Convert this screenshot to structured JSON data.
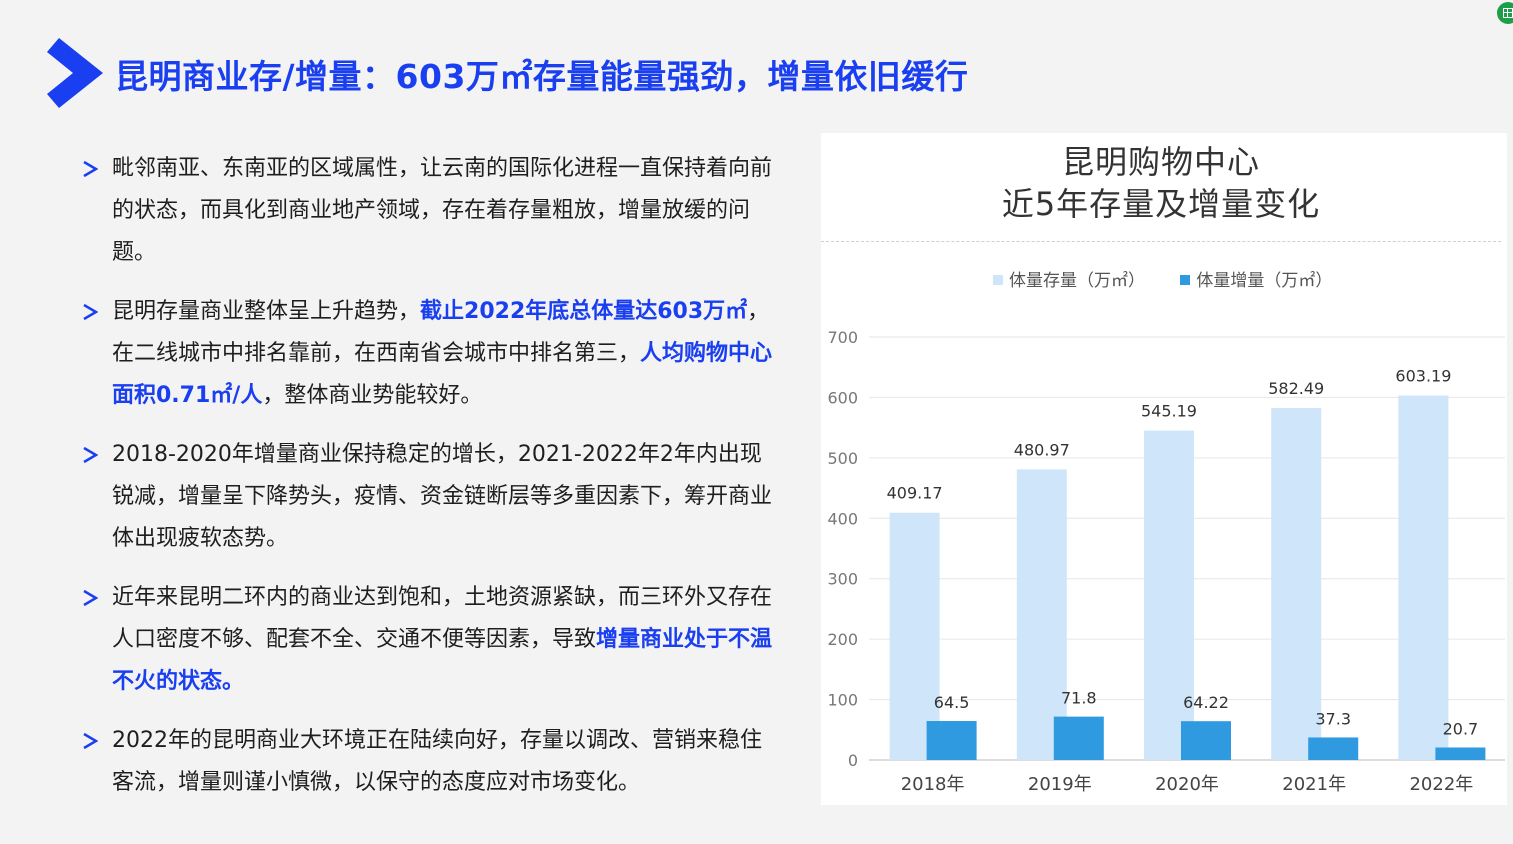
{
  "slide": {
    "title": "昆明商业存/增量：603万㎡存量能量强劲，增量依旧缓行",
    "corner_icon": "spreadsheet-icon",
    "accent_color": "#1a3ff0"
  },
  "bullets": [
    [
      {
        "text": "毗邻南亚、东南亚的区域属性，让云南的国际化进程一直保持着向前的状态，而具化到商业地产领域，存在着存量粗放，增量放缓的问题。",
        "hl": false
      }
    ],
    [
      {
        "text": "昆明存量商业整体呈上升趋势，",
        "hl": false
      },
      {
        "text": "截止2022年底总体量达603万㎡",
        "hl": true
      },
      {
        "text": "，在二线城市中排名靠前，在西南省会城市中排名第三，",
        "hl": false
      },
      {
        "text": "人均购物中心面积0.71㎡/人",
        "hl": true
      },
      {
        "text": "，整体商业势能较好。",
        "hl": false
      }
    ],
    [
      {
        "text": "2018-2020年增量商业保持稳定的增长，2021-2022年2年内出现锐减，增量呈下降势头，疫情、资金链断层等多重因素下，筹开商业体出现疲软态势。",
        "hl": false
      }
    ],
    [
      {
        "text": "近年来昆明二环内的商业达到饱和，土地资源紧缺，而三环外又存在人口密度不够、配套不全、交通不便等因素，导致",
        "hl": false
      },
      {
        "text": "增量商业处于不温不火的状态。",
        "hl": true
      }
    ],
    [
      {
        "text": "2022年的昆明商业大环境正在陆续向好，存量以调改、营销来稳住客流，增量则谨小慎微，以保守的态度应对市场变化。",
        "hl": false
      }
    ]
  ],
  "chart_data": {
    "type": "bar",
    "title_line1": "昆明购物中心",
    "title_line2": "近5年存量及增量变化",
    "categories": [
      "2018年",
      "2019年",
      "2020年",
      "2021年",
      "2022年"
    ],
    "series": [
      {
        "name": "体量存量（万㎡）",
        "values": [
          409.17,
          480.97,
          545.19,
          582.49,
          603.19
        ],
        "color": "#cfe6fa"
      },
      {
        "name": "体量增量（万㎡）",
        "values": [
          64.5,
          71.8,
          64.22,
          37.3,
          20.7
        ],
        "color": "#2f9ae0"
      }
    ],
    "value_labels": [
      [
        "409.17",
        "480.97",
        "545.19",
        "582.49",
        "603.19"
      ],
      [
        "64.5",
        "71.8",
        "64.22",
        "37.3",
        "20.7"
      ]
    ],
    "ylim": [
      0,
      700
    ],
    "yticks": [
      "0",
      "100",
      "200",
      "300",
      "400",
      "500",
      "600",
      "700"
    ],
    "grid": true,
    "legend_position": "top"
  }
}
